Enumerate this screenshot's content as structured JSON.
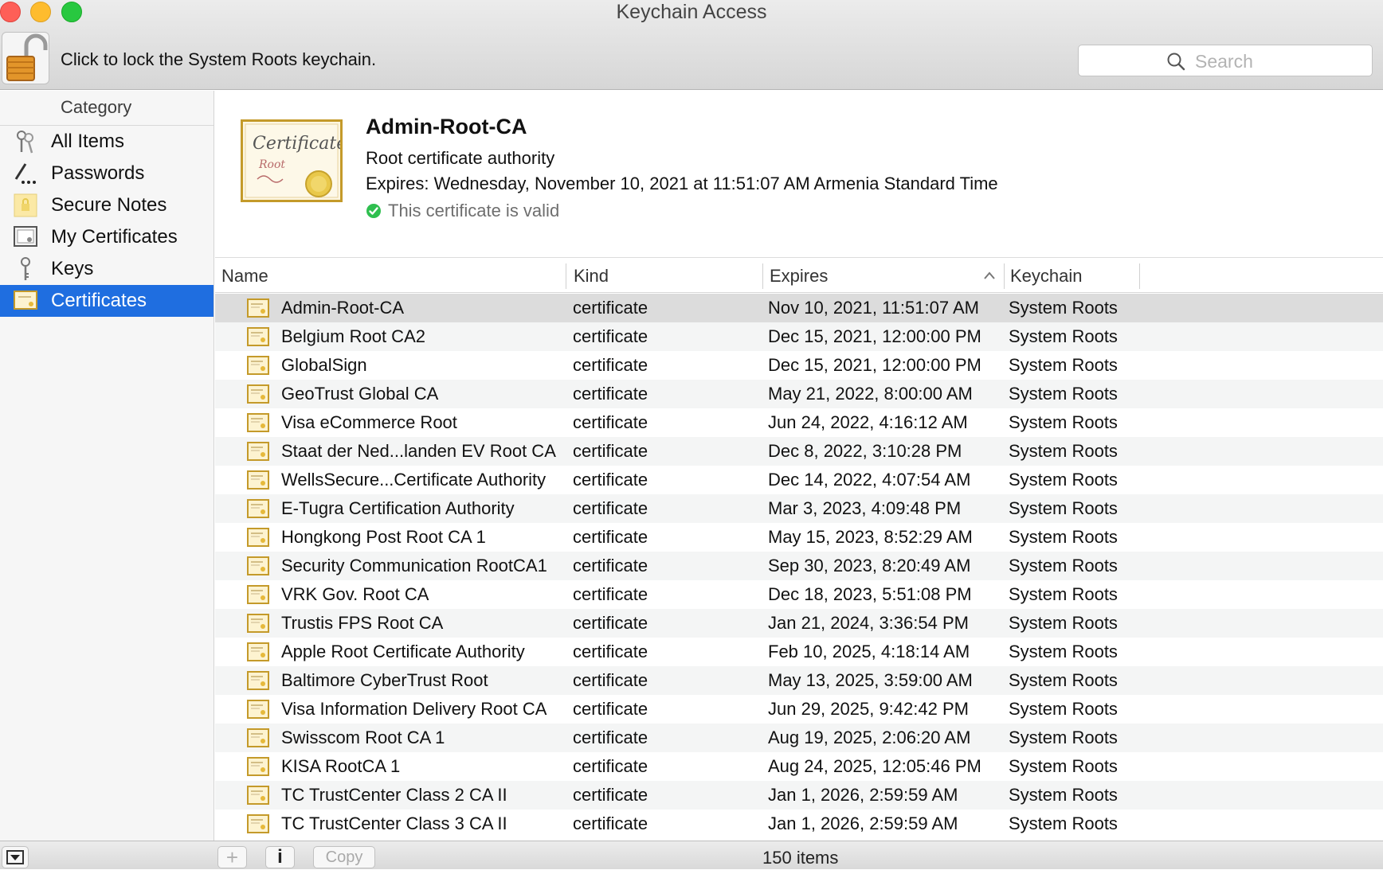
{
  "window": {
    "title": "Keychain Access"
  },
  "toolbar": {
    "lock_hint": "Click to lock the System Roots keychain.",
    "search_placeholder": "Search"
  },
  "sidebar": {
    "header": "Category",
    "items": [
      {
        "label": "All Items",
        "icon": "all-items-keys-icon",
        "selected": false
      },
      {
        "label": "Passwords",
        "icon": "pencil-icon",
        "selected": false
      },
      {
        "label": "Secure Notes",
        "icon": "secure-note-icon",
        "selected": false
      },
      {
        "label": "My Certificates",
        "icon": "my-certificate-icon",
        "selected": false
      },
      {
        "label": "Keys",
        "icon": "key-icon",
        "selected": false
      },
      {
        "label": "Certificates",
        "icon": "certificate-icon",
        "selected": true
      }
    ]
  },
  "detail": {
    "name": "Admin-Root-CA",
    "kind_description": "Root certificate authority",
    "expires": "Expires: Wednesday, November 10, 2021 at 11:51:07 AM Armenia Standard Time",
    "status": "This certificate is valid",
    "image_text": "Certificate",
    "image_subtext": "Root"
  },
  "table": {
    "columns": {
      "name": "Name",
      "kind": "Kind",
      "expires": "Expires",
      "keychain": "Keychain"
    },
    "sorted_column": "Expires",
    "sort_direction": "ascending",
    "rows": [
      {
        "name": "Admin-Root-CA",
        "kind": "certificate",
        "expires": "Nov 10, 2021, 11:51:07 AM",
        "keychain": "System Roots",
        "selected": true
      },
      {
        "name": "Belgium Root CA2",
        "kind": "certificate",
        "expires": "Dec 15, 2021, 12:00:00 PM",
        "keychain": "System Roots"
      },
      {
        "name": "GlobalSign",
        "kind": "certificate",
        "expires": "Dec 15, 2021, 12:00:00 PM",
        "keychain": "System Roots"
      },
      {
        "name": "GeoTrust Global CA",
        "kind": "certificate",
        "expires": "May 21, 2022, 8:00:00 AM",
        "keychain": "System Roots"
      },
      {
        "name": "Visa eCommerce Root",
        "kind": "certificate",
        "expires": "Jun 24, 2022, 4:16:12 AM",
        "keychain": "System Roots"
      },
      {
        "name": "Staat der Ned...landen EV Root CA",
        "kind": "certificate",
        "expires": "Dec 8, 2022, 3:10:28 PM",
        "keychain": "System Roots"
      },
      {
        "name": "WellsSecure...Certificate Authority",
        "kind": "certificate",
        "expires": "Dec 14, 2022, 4:07:54 AM",
        "keychain": "System Roots"
      },
      {
        "name": "E-Tugra Certification Authority",
        "kind": "certificate",
        "expires": "Mar 3, 2023, 4:09:48 PM",
        "keychain": "System Roots"
      },
      {
        "name": "Hongkong Post Root CA 1",
        "kind": "certificate",
        "expires": "May 15, 2023, 8:52:29 AM",
        "keychain": "System Roots"
      },
      {
        "name": "Security Communication RootCA1",
        "kind": "certificate",
        "expires": "Sep 30, 2023, 8:20:49 AM",
        "keychain": "System Roots"
      },
      {
        "name": "VRK Gov. Root CA",
        "kind": "certificate",
        "expires": "Dec 18, 2023, 5:51:08 PM",
        "keychain": "System Roots"
      },
      {
        "name": "Trustis FPS Root CA",
        "kind": "certificate",
        "expires": "Jan 21, 2024, 3:36:54 PM",
        "keychain": "System Roots"
      },
      {
        "name": "Apple Root Certificate Authority",
        "kind": "certificate",
        "expires": "Feb 10, 2025, 4:18:14 AM",
        "keychain": "System Roots"
      },
      {
        "name": "Baltimore CyberTrust Root",
        "kind": "certificate",
        "expires": "May 13, 2025, 3:59:00 AM",
        "keychain": "System Roots"
      },
      {
        "name": "Visa Information Delivery Root CA",
        "kind": "certificate",
        "expires": "Jun 29, 2025, 9:42:42 PM",
        "keychain": "System Roots"
      },
      {
        "name": "Swisscom Root CA 1",
        "kind": "certificate",
        "expires": "Aug 19, 2025, 2:06:20 AM",
        "keychain": "System Roots"
      },
      {
        "name": "KISA RootCA 1",
        "kind": "certificate",
        "expires": "Aug 24, 2025, 12:05:46 PM",
        "keychain": "System Roots"
      },
      {
        "name": "TC TrustCenter Class 2 CA II",
        "kind": "certificate",
        "expires": "Jan 1, 2026, 2:59:59 AM",
        "keychain": "System Roots"
      },
      {
        "name": "TC TrustCenter Class 3 CA II",
        "kind": "certificate",
        "expires": "Jan 1, 2026, 2:59:59 AM",
        "keychain": "System Roots"
      }
    ]
  },
  "bottom_bar": {
    "add_label": "+",
    "info_label": "i",
    "copy_label": "Copy",
    "item_count": "150 items"
  },
  "colors": {
    "selection_blue": "#1f6ee0",
    "valid_green": "#2fbf4f",
    "certificate_gold": "#c49a2a"
  }
}
